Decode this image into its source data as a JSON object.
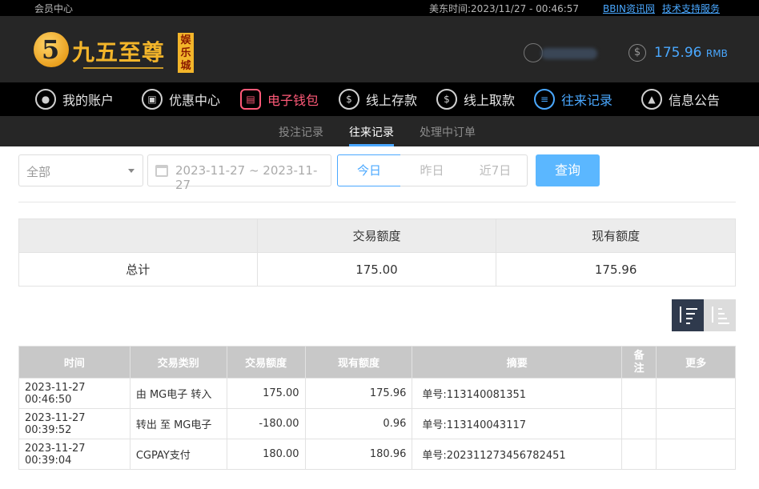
{
  "topbar": {
    "member_center": "会员中心",
    "time_label": "美东时间:",
    "time_value": "2023/11/27 - 00:46:57",
    "link_bbin": "BBIN资讯网",
    "link_support": "技术支持服务"
  },
  "header": {
    "logo_brand": "九五至尊",
    "logo_sub": "娱乐城",
    "balance_value": "175.96",
    "balance_unit": "RMB"
  },
  "mainnav": [
    {
      "label": "我的账户",
      "icon": "user-icon"
    },
    {
      "label": "优惠中心",
      "icon": "gift-icon"
    },
    {
      "label": "电子钱包",
      "icon": "wallet-icon"
    },
    {
      "label": "线上存款",
      "icon": "deposit-icon"
    },
    {
      "label": "线上取款",
      "icon": "withdraw-icon"
    },
    {
      "label": "往来记录",
      "icon": "record-icon"
    },
    {
      "label": "信息公告",
      "icon": "bell-icon"
    }
  ],
  "subnav": [
    {
      "label": "投注记录"
    },
    {
      "label": "往来记录"
    },
    {
      "label": "处理中订单"
    }
  ],
  "filter": {
    "type_selected": "全部",
    "date_range": "2023-11-27 ~ 2023-11-27",
    "quick": [
      "今日",
      "昨日",
      "近7日"
    ],
    "search_label": "查询"
  },
  "summary": {
    "headers": [
      "",
      "交易额度",
      "现有额度"
    ],
    "total_label": "总计",
    "total_amount": "175.00",
    "total_balance": "175.96"
  },
  "records": {
    "headers": [
      "时间",
      "交易类别",
      "交易额度",
      "现有额度",
      "摘要",
      "备注",
      "更多"
    ],
    "rows": [
      [
        "2023-11-27 00:46:50",
        "由 MG电子 转入",
        "175.00",
        "175.96",
        "单号:113140081351",
        "",
        ""
      ],
      [
        "2023-11-27 00:39:52",
        "转出 至 MG电子",
        "-180.00",
        "0.96",
        "单号:113140043117",
        "",
        ""
      ],
      [
        "2023-11-27 00:39:04",
        "CGPAY支付",
        "180.00",
        "180.96",
        "单号:202311273456782451",
        "",
        ""
      ]
    ]
  }
}
